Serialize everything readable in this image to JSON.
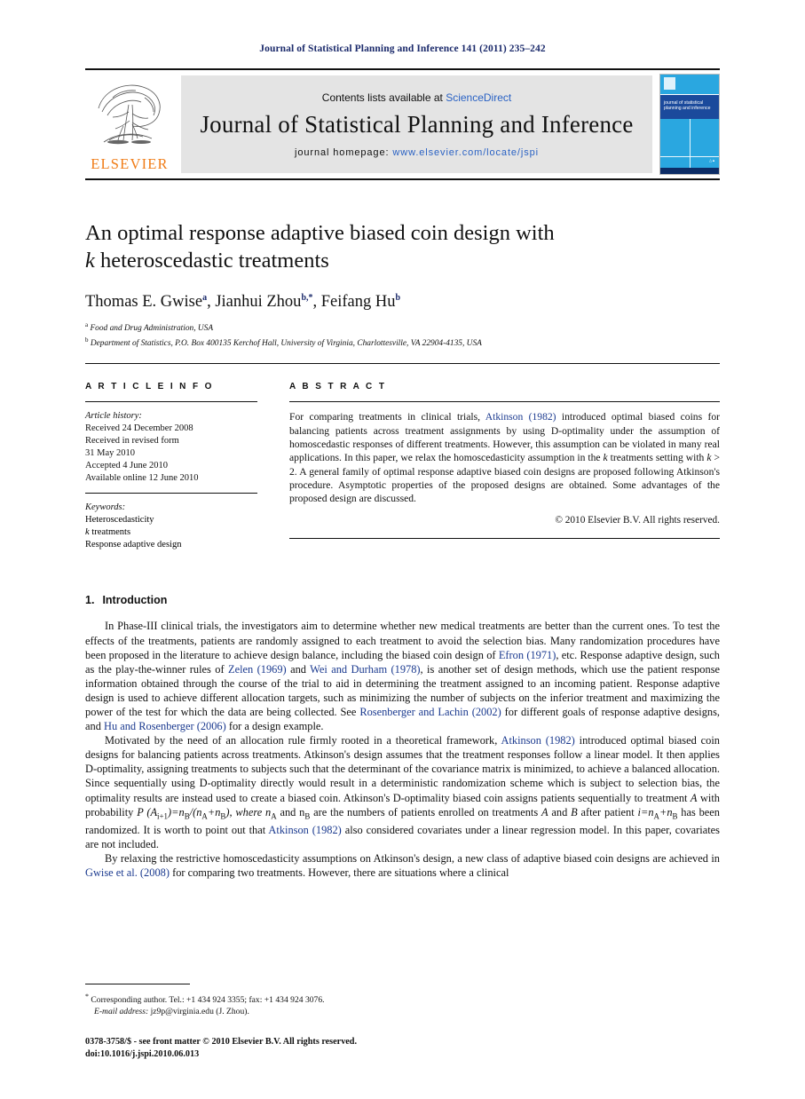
{
  "running_head": "Journal of Statistical Planning and Inference 141 (2011) 235–242",
  "masthead": {
    "contents_prefix": "Contents lists available at ",
    "sciencedirect": "ScienceDirect",
    "journal_title": "Journal of Statistical Planning and Inference",
    "homepage_prefix": "journal homepage: ",
    "homepage_url": "www.elsevier.com/locate/jspi",
    "publisher": "ELSEVIER",
    "publisher_color": "#f07c17",
    "link_color": "#2a62c4",
    "cover_text": "journal of statistical planning and inference",
    "cover_color": "#2aa7e0",
    "cover_band_color": "#1b4a9c"
  },
  "article": {
    "title_line1": "An optimal response adaptive biased coin design with",
    "title_line2_italic": "k",
    "title_line2_rest": " heteroscedastic treatments",
    "authors": [
      {
        "name": "Thomas E. Gwise",
        "marker": "a"
      },
      {
        "name": "Jianhui Zhou",
        "marker": "b,*"
      },
      {
        "name": "Feifang Hu",
        "marker": "b"
      }
    ],
    "affiliations": [
      {
        "marker": "a",
        "text": "Food and Drug Administration, USA"
      },
      {
        "marker": "b",
        "text": "Department of Statistics, P.O. Box 400135 Kerchof Hall, University of Virginia, Charlottesville, VA 22904-4135, USA"
      }
    ]
  },
  "info": {
    "heading": "A R T I C L E   I N F O",
    "history_label": "Article history:",
    "history": [
      "Received 24 December 2008",
      "Received in revised form",
      "31 May 2010",
      "Accepted 4 June 2010",
      "Available online 12 June 2010"
    ],
    "keywords_label": "Keywords:",
    "keywords": [
      {
        "pre": "",
        "ital": "",
        "post": "Heteroscedasticity"
      },
      {
        "pre": "",
        "ital": "k",
        "post": " treatments"
      },
      {
        "pre": "",
        "ital": "",
        "post": "Response adaptive design"
      }
    ]
  },
  "abstract": {
    "heading": "A B S T R A C T",
    "p1_a": "For comparing treatments in clinical trials, ",
    "p1_cite1": "Atkinson (1982)",
    "p1_b": " introduced optimal biased coins for balancing patients across treatment assignments by using D-optimality under the assumption of homoscedastic responses of different treatments. However, this assumption can be violated in many real applications. In this paper, we relax the homoscedasticity assumption in the ",
    "p1_k1": "k",
    "p1_c": " treatments setting with ",
    "p1_k2": "k",
    "p1_d": " > 2. A general family of optimal response adaptive biased coin designs are proposed following Atkinson's procedure. Asymptotic properties of the proposed designs are obtained. Some advantages of the proposed design are discussed.",
    "copyright": "© 2010 Elsevier B.V. All rights reserved."
  },
  "section1": {
    "number": "1.",
    "title": "Introduction",
    "para1_a": "In Phase-III clinical trials, the investigators aim to determine whether new medical treatments are better than the current ones. To test the effects of the treatments, patients are randomly assigned to each treatment to avoid the selection bias. Many randomization procedures have been proposed in the literature to achieve design balance, including the biased coin design of ",
    "para1_cite1": "Efron (1971)",
    "para1_b": ", etc. Response adaptive design, such as the play-the-winner rules of ",
    "para1_cite2": "Zelen (1969)",
    "para1_c": " and ",
    "para1_cite3": "Wei and Durham (1978)",
    "para1_d": ", is another set of design methods, which use the patient response information obtained through the course of the trial to aid in determining the treatment assigned to an incoming patient. Response adaptive design is used to achieve different allocation targets, such as minimizing the number of subjects on the inferior treatment and maximizing the power of the test for which the data are being collected. See ",
    "para1_cite4": "Rosenberger and Lachin (2002)",
    "para1_e": " for different goals of response adaptive designs, and ",
    "para1_cite5": "Hu and Rosenberger (2006)",
    "para1_f": " for a design example.",
    "para2_a": "Motivated by the need of an allocation rule firmly rooted in a theoretical framework, ",
    "para2_cite1": "Atkinson (1982)",
    "para2_b": " introduced optimal biased coin designs for balancing patients across treatments. Atkinson's design assumes that the treatment responses follow a linear model. It then applies D-optimality, assigning treatments to subjects such that the determinant of the covariance matrix is minimized, to achieve a balanced allocation. Since sequentially using D-optimality directly would result in a deterministic randomization scheme which is subject to selection bias, the optimality results are instead used to create a biased coin. Atkinson's D-optimality biased coin assigns patients sequentially to treatment ",
    "para2_A1": "A",
    "para2_c": " with probability ",
    "para2_formula": "P (A",
    "para2_formula_sub1": "i+1",
    "para2_formula2": ")=n",
    "para2_formula_sub2": "B",
    "para2_formula3": "/(n",
    "para2_formula_sub3": "A",
    "para2_formula4": "+n",
    "para2_formula_sub4": "B",
    "para2_formula5": "), where n",
    "para2_formula_sub5": "A",
    "para2_d": " and n",
    "para2_formula_sub6": "B",
    "para2_e": " are the numbers of patients enrolled on treatments ",
    "para2_A2": "A",
    "para2_f": " and ",
    "para2_B2": "B",
    "para2_g": " after patient ",
    "para2_i": "i",
    "para2_h": "=n",
    "para2_sub7": "A",
    "para2_h2": "+n",
    "para2_sub8": "B",
    "para2_h3": " has been randomized. It is worth to point out that ",
    "para2_cite2": "Atkinson (1982)",
    "para2_i2": " also considered covariates under a linear regression model. In this paper, covariates are not included.",
    "para3_a": "By relaxing the restrictive homoscedasticity assumptions on Atkinson's design, a new class of adaptive biased coin designs are achieved in ",
    "para3_cite1": "Gwise et al. (2008)",
    "para3_b": " for comparing two treatments. However, there are situations where a clinical"
  },
  "footnotes": {
    "corr_marker": "*",
    "corr_text": "Corresponding author. Tel.: +1 434 924 3355; fax: +1 434 924 3076.",
    "email_label": "E-mail address:",
    "email_value": " jz9p@virginia.edu (J. Zhou).",
    "issn_line": "0378-3758/$ - see front matter © 2010 Elsevier B.V. All rights reserved.",
    "doi_line": "doi:10.1016/j.jspi.2010.06.013"
  }
}
